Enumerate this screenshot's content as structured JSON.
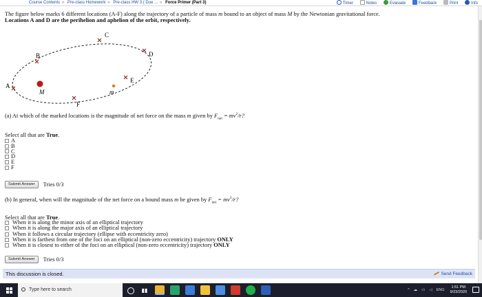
{
  "breadcrumb": {
    "items": [
      "Course Contents",
      "Pre-class Homework",
      "Pre-class HW 3 ( Due ...",
      "Force Primer (Part 3)"
    ],
    "separator": "»"
  },
  "toolbar": {
    "timer": "Timer",
    "notes": "Notes",
    "evaluate": "Evaluate",
    "feedback": "Feedback",
    "print": "Print",
    "info": "Info"
  },
  "intro": {
    "line1_a": "The figure below marks 6 different locations (A-F) along the trajectory of a particle of mass ",
    "line1_m": "m",
    "line1_b": " bound to an object of mass ",
    "line1_M": "M",
    "line1_c": " by the Newtonian gravitational force.",
    "line2": "Locations A and D are the perihelion and aphelion of the orbit, respectively."
  },
  "diagram": {
    "labels": [
      "A",
      "B",
      "C",
      "D",
      "E",
      "F"
    ],
    "mass_big": "M",
    "mass_small": "m",
    "colors": {
      "orbit": "#222222",
      "marker": "#8b1a1a",
      "big_mass": "#c01616",
      "small_mass": "#d67a2a"
    }
  },
  "question_a": {
    "prefix": "(a) At which of the marked locations is the magnitude of net force on the mass ",
    "mass": "m",
    "mid": " given by ",
    "formula": "F",
    "formula_sub": "net",
    "formula_rest": " = mv",
    "formula_sup": "2",
    "formula_end": "/r?",
    "select_prefix": "Select all that are ",
    "select_bold": "True",
    "select_suffix": ".",
    "options": [
      "A",
      "B",
      "C",
      "D",
      "E",
      "F"
    ],
    "submit": "Submit Answer",
    "tries": "Tries 0/3"
  },
  "question_b": {
    "prefix": "(b) In general, when will the magnitude of the net force on a bound mass ",
    "mass": "m",
    "mid": " be given by ",
    "formula": "F",
    "formula_sub": "net",
    "formula_rest": " = mv",
    "formula_sup": "2",
    "formula_end": "/r?",
    "select_prefix": "Select all that are ",
    "select_bold": "True",
    "select_suffix": ".",
    "options": [
      {
        "text": "When it is along the minor axis of an elliptical trajectory",
        "bold": ""
      },
      {
        "text": "When it is along the major axis of an elliptical trajectory",
        "bold": ""
      },
      {
        "text": "When it follows a circular trajectory (ellipse with eccentricity zero)",
        "bold": ""
      },
      {
        "text": "When it is farthest from one of the foci on an elliptical (non-zero eccentricity) trajectory",
        "bold": "ONLY"
      },
      {
        "text": "When it is closest to either of the foci on an elliptical (non-zero eccentricity) trajectory",
        "bold": "ONLY"
      }
    ],
    "submit": "Submit Answer",
    "tries": "Tries 0/3"
  },
  "discussion": {
    "status": "This discussion is closed.",
    "send_feedback": "Send Feedback"
  },
  "taskbar": {
    "search_placeholder": "Type here to search",
    "language": "ENG",
    "time": "1:51 PM",
    "date": "9/23/2020"
  }
}
